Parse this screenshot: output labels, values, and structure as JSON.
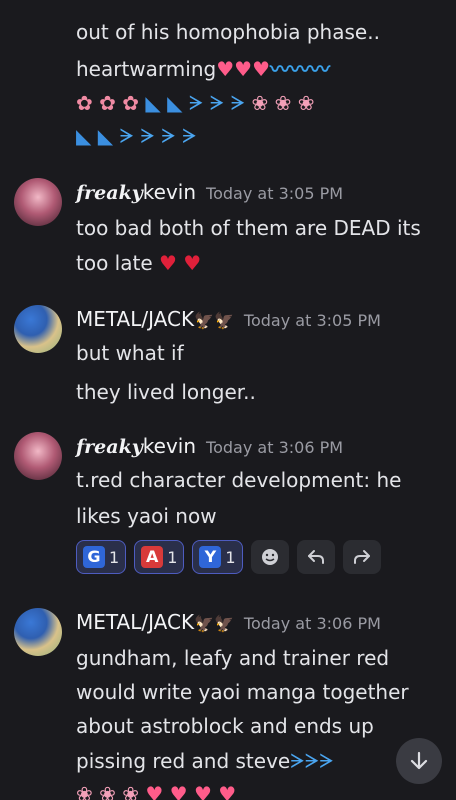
{
  "colors": {
    "background": "#1a1a1e",
    "text": "#e3e4e8",
    "timestamp": "#9a9ba3",
    "reaction_border": "#4e5cc0",
    "letter_g": "#2f66d8",
    "letter_a": "#d83a3a",
    "letter_y": "#2f66d8"
  },
  "message0": {
    "line0": "out of his homophobia phase..",
    "line1_text": "heartwarming"
  },
  "message1": {
    "username_prefix": "freaky",
    "username": "kevin",
    "timestamp": "Today at 3:05 PM",
    "line0": "too bad both of them are DEAD its",
    "line1": "too late"
  },
  "message2": {
    "username": "METAL/JACK",
    "timestamp": "Today at 3:05 PM",
    "line0": "but what if",
    "line1": "they lived longer.."
  },
  "message3": {
    "username_prefix": "freaky",
    "username": "kevin",
    "timestamp": "Today at 3:06 PM",
    "line0": "t.red character development: he",
    "line1": "likes yaoi now",
    "reactions": [
      {
        "letter": "G",
        "count": "1"
      },
      {
        "letter": "A",
        "count": "1"
      },
      {
        "letter": "Y",
        "count": "1"
      }
    ],
    "actions": [
      "add-reaction-icon",
      "reply-icon",
      "forward-icon"
    ]
  },
  "message4": {
    "username": "METAL/JACK",
    "timestamp": "Today at 3:06 PM",
    "line0": "gundham, leafy and trainer red",
    "line1": "would write yaoi manga together",
    "line2": "about astroblock and ends up",
    "line3": "pissing red and steve"
  },
  "scroll_button_icon": "arrow-down-icon"
}
